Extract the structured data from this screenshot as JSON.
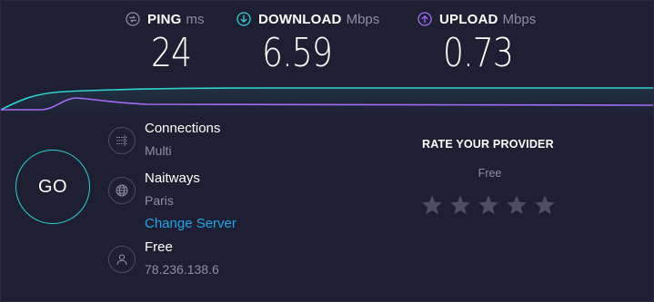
{
  "metrics": {
    "ping": {
      "label": "PING",
      "unit": "ms",
      "value": "24",
      "icon": "ping-icon",
      "color": "#8d8ea6"
    },
    "download": {
      "label": "DOWNLOAD",
      "unit": "Mbps",
      "value": "6.59",
      "icon": "download-arrow-icon",
      "color": "#2fd1d0"
    },
    "upload": {
      "label": "UPLOAD",
      "unit": "Mbps",
      "value": "0.73",
      "icon": "upload-arrow-icon",
      "color": "#a66cf5"
    }
  },
  "go_button": {
    "label": "GO"
  },
  "connections": {
    "title": "Connections",
    "value": "Multi",
    "icon": "connections-icon"
  },
  "server": {
    "name": "Naitways",
    "location": "Paris",
    "change_label": "Change Server",
    "icon": "globe-icon"
  },
  "provider": {
    "name": "Free",
    "ip": "78.236.138.6",
    "icon": "user-icon"
  },
  "rating": {
    "title": "RATE YOUR PROVIDER",
    "provider": "Free",
    "max_stars": 5,
    "selected_stars": 0
  },
  "colors": {
    "background": "#1e1f33",
    "download_accent": "#2fd1d0",
    "upload_accent": "#a66cf5",
    "link": "#1fa6e8",
    "muted_text": "#8d8ea6",
    "star": "#4d4e66"
  }
}
